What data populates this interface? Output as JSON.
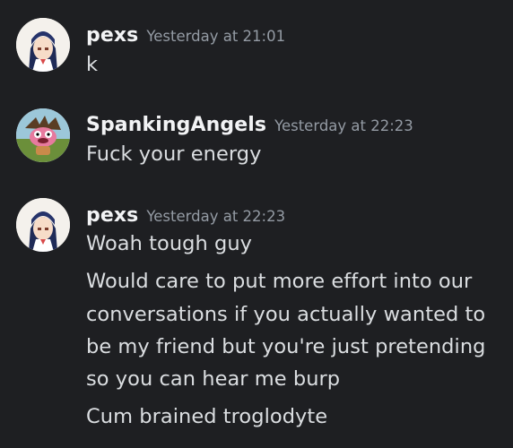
{
  "messages": [
    {
      "author": "pexs",
      "avatar_icon": "anime-girl-avatar-icon",
      "timestamp": "Yesterday at 21:01",
      "lines": [
        "k"
      ]
    },
    {
      "author": "SpankingAngels",
      "avatar_icon": "cartoon-dog-avatar-icon",
      "timestamp": "Yesterday at 22:23",
      "lines": [
        "Fuck your energy"
      ]
    },
    {
      "author": "pexs",
      "avatar_icon": "anime-girl-avatar-icon",
      "timestamp": "Yesterday at 22:23",
      "lines": [
        "Woah tough guy",
        "Would care to put more effort into our",
        "conversations if you actually wanted to",
        "be my friend but you're just pretending",
        "so you can hear me burp",
        "Cum brained troglodyte"
      ]
    }
  ],
  "colors": {
    "background": "#1e1f22",
    "username": "#f2f3f5",
    "timestamp": "#949ba4",
    "message_text": "#dbdee1"
  }
}
